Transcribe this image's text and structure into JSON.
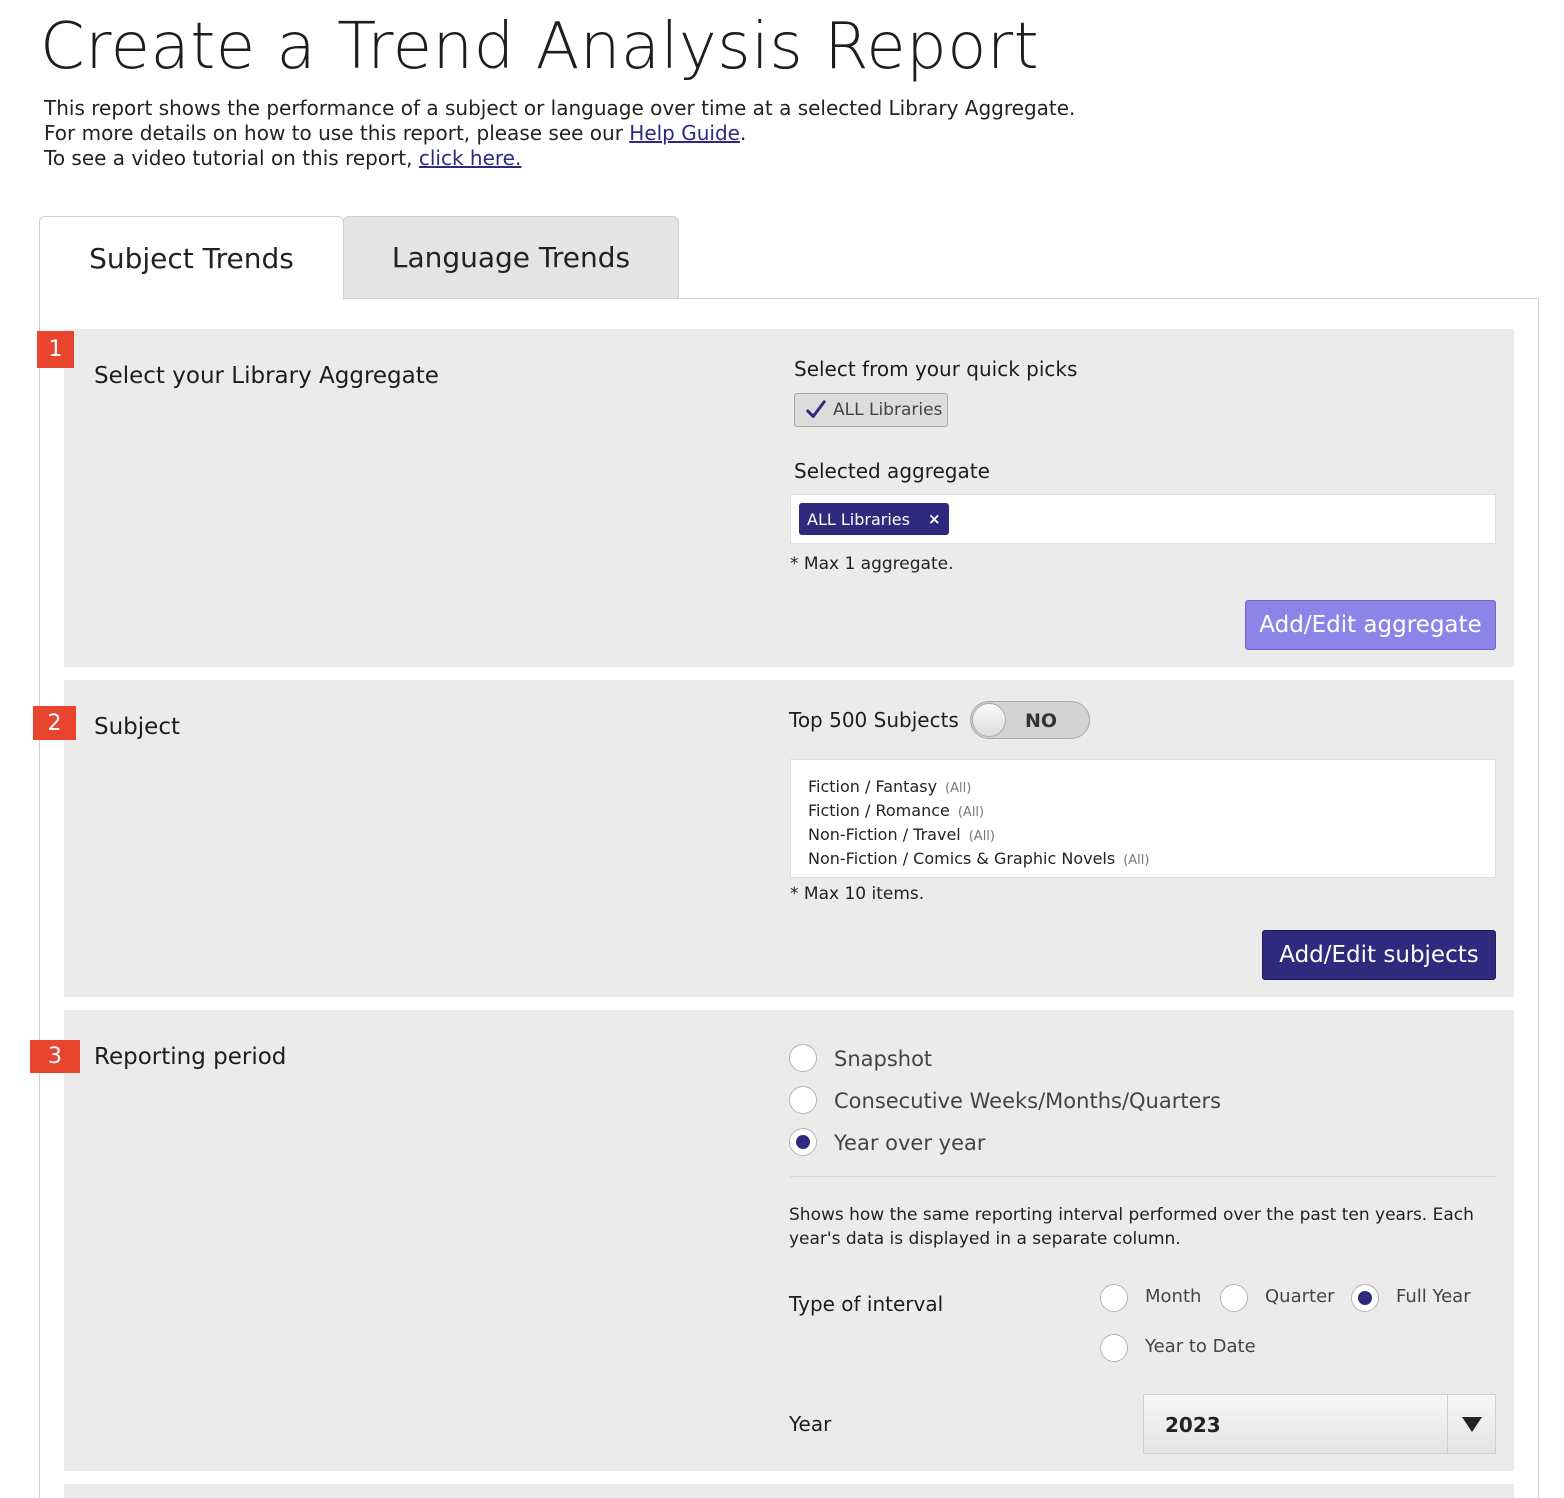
{
  "page": {
    "title": "Create a Trend Analysis Report",
    "intro_line1": "This report shows the performance of a subject or language over time at a selected Library Aggregate.",
    "intro_line2_prefix": "For more details on how to use this report, please see our ",
    "help_link": "Help Guide",
    "intro_line2_suffix": ".",
    "intro_line3_prefix": "To see a video tutorial on this report, ",
    "video_link": "click here."
  },
  "tabs": [
    {
      "label": "Subject Trends",
      "active": true
    },
    {
      "label": "Language Trends",
      "active": false
    }
  ],
  "section1": {
    "number": "1",
    "label": "Select your Library Aggregate",
    "quick_picks_label": "Select from your quick picks",
    "quick_pick": "ALL Libraries",
    "selected_label": "Selected aggregate",
    "selected_chip": "ALL Libraries",
    "chip_remove": "×",
    "max_note": "* Max 1 aggregate.",
    "button": "Add/Edit aggregate"
  },
  "section2": {
    "number": "2",
    "label": "Subject",
    "top500_label": "Top 500 Subjects",
    "toggle_value": "NO",
    "items": [
      {
        "name": "Fiction / Fantasy",
        "scope": "(All)"
      },
      {
        "name": "Fiction / Romance",
        "scope": "(All)"
      },
      {
        "name": "Non-Fiction / Travel",
        "scope": "(All)"
      },
      {
        "name": "Non-Fiction / Comics & Graphic Novels",
        "scope": "(All)"
      }
    ],
    "max_note": "* Max 10 items.",
    "button": "Add/Edit subjects"
  },
  "section3": {
    "number": "3",
    "label": "Reporting period",
    "period_options": [
      {
        "label": "Snapshot",
        "selected": false
      },
      {
        "label": "Consecutive Weeks/Months/Quarters",
        "selected": false
      },
      {
        "label": "Year over year",
        "selected": true
      }
    ],
    "description_line1": "Shows how the same reporting interval performed over the past ten years.  Each",
    "description_line2": "year's data is displayed in a separate column.",
    "interval_label": "Type of interval",
    "interval_options": [
      {
        "label": "Month",
        "selected": false
      },
      {
        "label": "Quarter",
        "selected": false
      },
      {
        "label": "Full Year",
        "selected": true
      },
      {
        "label": "Year to Date",
        "selected": false
      }
    ],
    "year_label": "Year",
    "year_value": "2023"
  },
  "colors": {
    "accent": "#2e2a7d",
    "accent_light": "#8c84e8",
    "badge": "#e8442e",
    "section_bg": "#ebebeb"
  }
}
